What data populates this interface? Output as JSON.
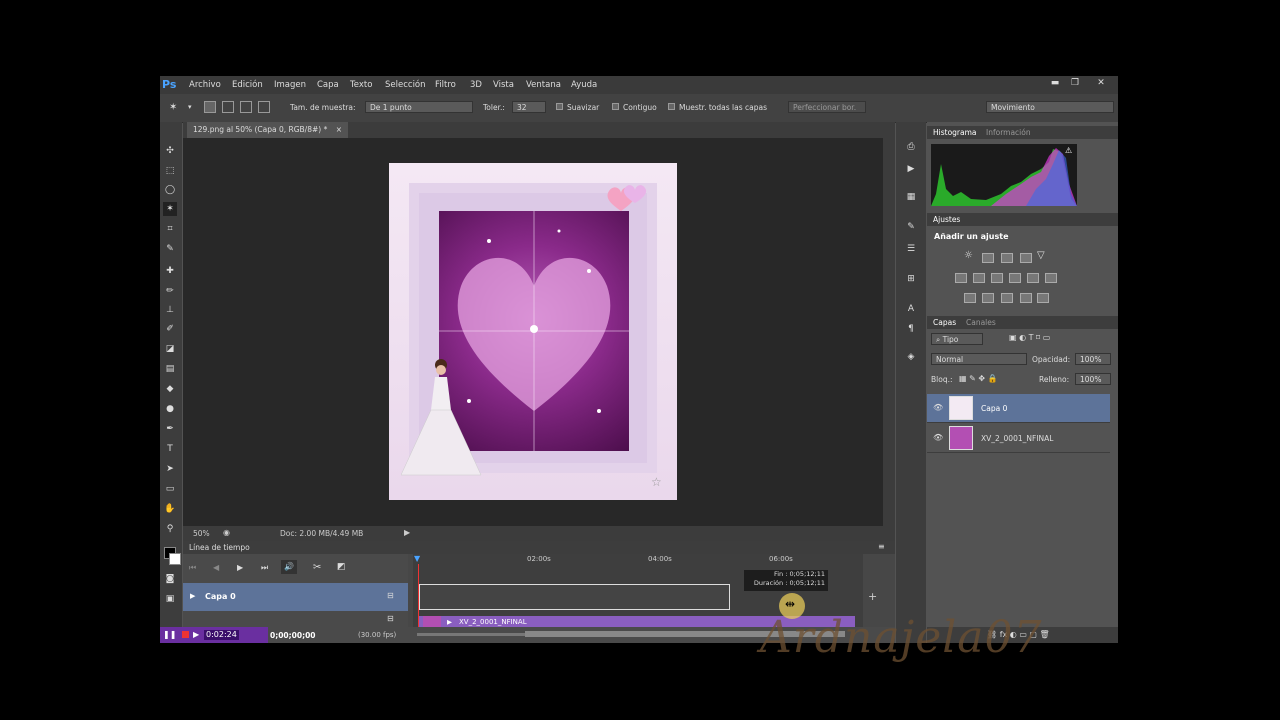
{
  "app": {
    "logo": "Ps"
  },
  "menu": [
    "Archivo",
    "Edición",
    "Imagen",
    "Capa",
    "Texto",
    "Selección",
    "Filtro",
    "3D",
    "Vista",
    "Ventana",
    "Ayuda"
  ],
  "options": {
    "sample_size_label": "Tam. de muestra:",
    "sample_size_value": "De 1 punto",
    "tolerance_label": "Toler.:",
    "tolerance_value": "32",
    "smooth_label": "Suavizar",
    "contiguous_label": "Contiguo",
    "sample_all_label": "Muestr. todas las capas",
    "refine_label": "Perfeccionar bor.",
    "workspace": "Movimiento"
  },
  "document": {
    "tab_title": "129.png al 50% (Capa 0, RGB/8#) *",
    "zoom": "50%",
    "doc_size": "Doc: 2.00 MB/4.49 MB"
  },
  "panels": {
    "histogram_tab": "Histograma",
    "info_tab": "Información",
    "adjustments_tab": "Ajustes",
    "add_adjustment": "Añadir un ajuste",
    "layers_tab": "Capas",
    "channels_tab": "Canales",
    "filter_kind": "Tipo",
    "blend_mode": "Normal",
    "opacity_label": "Opacidad:",
    "opacity_value": "100%",
    "lock_label": "Bloq.:",
    "fill_label": "Relleno:",
    "fill_value": "100%",
    "layers": [
      "Capa 0",
      "XV_2_0001_NFINAL"
    ]
  },
  "timeline": {
    "title": "Línea de tiempo",
    "ticks": [
      "02:00s",
      "04:00s",
      "06:00s"
    ],
    "tooltip_end_label": "Fin",
    "tooltip_end_value": "0;05;12;11",
    "tooltip_duration_label": "Duración",
    "tooltip_duration_value": "0;05;12;11",
    "track_label": "Capa 0",
    "clip_label": "XV_2_0001_NFINAL",
    "current_time": "0;00;00;00",
    "fps": "(30.00 fps)",
    "recorder_time": "0:02:24"
  },
  "watermark": "Ardnajela07",
  "colors": {
    "accent": "#4aa3ff",
    "selected_layer": "#5d7399",
    "clip_purple": "#8a5ec0",
    "recorder": "#6a2fa0"
  }
}
